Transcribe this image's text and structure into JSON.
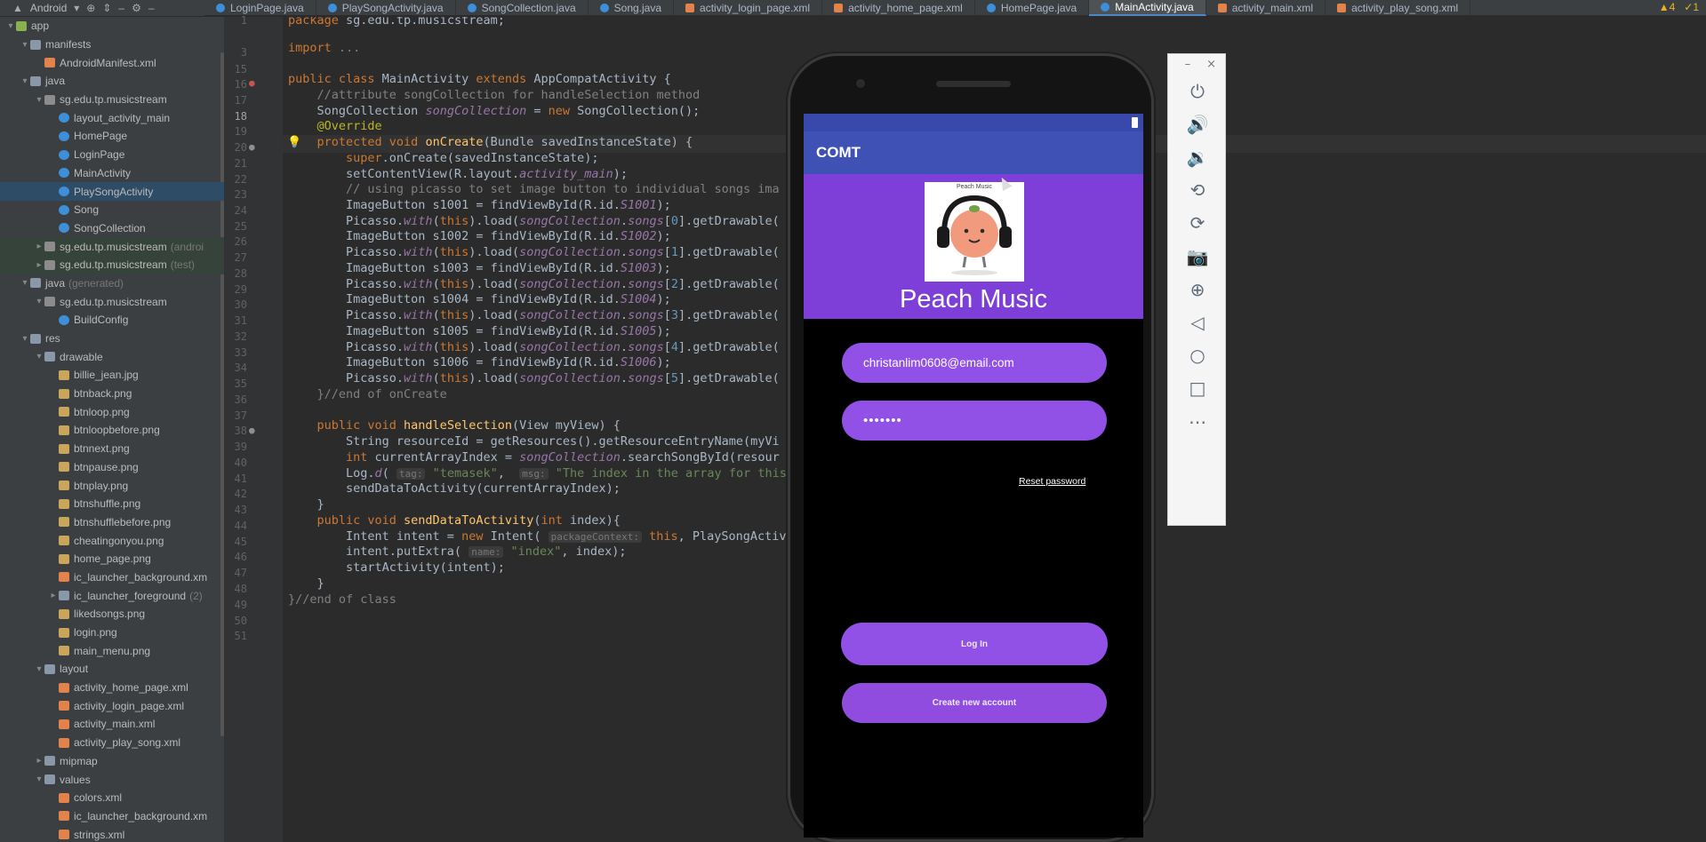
{
  "topbar": {
    "project_selector": "Android",
    "tabs": [
      {
        "label": "LoginPage.java",
        "type": "java"
      },
      {
        "label": "PlaySongActivity.java",
        "type": "java"
      },
      {
        "label": "SongCollection.java",
        "type": "java"
      },
      {
        "label": "Song.java",
        "type": "java"
      },
      {
        "label": "activity_login_page.xml",
        "type": "xml"
      },
      {
        "label": "activity_home_page.xml",
        "type": "xml"
      },
      {
        "label": "HomePage.java",
        "type": "java"
      },
      {
        "label": "MainActivity.java",
        "type": "java",
        "active": true
      },
      {
        "label": "activity_main.xml",
        "type": "xml"
      },
      {
        "label": "activity_play_song.xml",
        "type": "xml"
      }
    ],
    "warnings": "▲4",
    "errors": "✓1"
  },
  "tree": [
    {
      "label": "app",
      "indent": 0,
      "icon": "mod",
      "chev": "▾"
    },
    {
      "label": "manifests",
      "indent": 1,
      "icon": "folder",
      "chev": "▾"
    },
    {
      "label": "AndroidManifest.xml",
      "indent": 2,
      "icon": "xml",
      "chev": ""
    },
    {
      "label": "java",
      "indent": 1,
      "icon": "folder",
      "chev": "▾"
    },
    {
      "label": "sg.edu.tp.musicstream",
      "indent": 2,
      "icon": "pkg",
      "chev": "▾"
    },
    {
      "label": "layout_activity_main",
      "indent": 3,
      "icon": "cls",
      "chev": ""
    },
    {
      "label": "HomePage",
      "indent": 3,
      "icon": "cls",
      "chev": ""
    },
    {
      "label": "LoginPage",
      "indent": 3,
      "icon": "cls",
      "chev": ""
    },
    {
      "label": "MainActivity",
      "indent": 3,
      "icon": "cls",
      "chev": ""
    },
    {
      "label": "PlaySongActivity",
      "indent": 3,
      "icon": "cls",
      "chev": "",
      "selected": true
    },
    {
      "label": "Song",
      "indent": 3,
      "icon": "cls",
      "chev": ""
    },
    {
      "label": "SongCollection",
      "indent": 3,
      "icon": "cls",
      "chev": ""
    },
    {
      "label": "sg.edu.tp.musicstream",
      "suffix": "(androi",
      "indent": 2,
      "icon": "pkg",
      "chev": "▸",
      "modbg": true
    },
    {
      "label": "sg.edu.tp.musicstream",
      "suffix": "(test)",
      "indent": 2,
      "icon": "pkg",
      "chev": "▸",
      "modbg": true
    },
    {
      "label": "java",
      "suffix": "(generated)",
      "indent": 1,
      "icon": "folder",
      "chev": "▾"
    },
    {
      "label": "sg.edu.tp.musicstream",
      "indent": 2,
      "icon": "pkg",
      "chev": "▾"
    },
    {
      "label": "BuildConfig",
      "indent": 3,
      "icon": "cls",
      "chev": ""
    },
    {
      "label": "res",
      "indent": 1,
      "icon": "folder",
      "chev": "▾"
    },
    {
      "label": "drawable",
      "indent": 2,
      "icon": "folder",
      "chev": "▾"
    },
    {
      "label": "billie_jean.jpg",
      "indent": 3,
      "icon": "img",
      "chev": ""
    },
    {
      "label": "btnback.png",
      "indent": 3,
      "icon": "img",
      "chev": ""
    },
    {
      "label": "btnloop.png",
      "indent": 3,
      "icon": "img",
      "chev": ""
    },
    {
      "label": "btnloopbefore.png",
      "indent": 3,
      "icon": "img",
      "chev": ""
    },
    {
      "label": "btnnext.png",
      "indent": 3,
      "icon": "img",
      "chev": ""
    },
    {
      "label": "btnpause.png",
      "indent": 3,
      "icon": "img",
      "chev": ""
    },
    {
      "label": "btnplay.png",
      "indent": 3,
      "icon": "img",
      "chev": ""
    },
    {
      "label": "btnshuffle.png",
      "indent": 3,
      "icon": "img",
      "chev": ""
    },
    {
      "label": "btnshufflebefore.png",
      "indent": 3,
      "icon": "img",
      "chev": ""
    },
    {
      "label": "cheatingonyou.png",
      "indent": 3,
      "icon": "img",
      "chev": ""
    },
    {
      "label": "home_page.png",
      "indent": 3,
      "icon": "img",
      "chev": ""
    },
    {
      "label": "ic_launcher_background.xm",
      "indent": 3,
      "icon": "xml",
      "chev": ""
    },
    {
      "label": "ic_launcher_foreground",
      "suffix": "(2)",
      "indent": 3,
      "icon": "folder",
      "chev": "▸"
    },
    {
      "label": "likedsongs.png",
      "indent": 3,
      "icon": "img",
      "chev": ""
    },
    {
      "label": "login.png",
      "indent": 3,
      "icon": "img",
      "chev": ""
    },
    {
      "label": "main_menu.png",
      "indent": 3,
      "icon": "img",
      "chev": ""
    },
    {
      "label": "layout",
      "indent": 2,
      "icon": "folder",
      "chev": "▾"
    },
    {
      "label": "activity_home_page.xml",
      "indent": 3,
      "icon": "xml",
      "chev": ""
    },
    {
      "label": "activity_login_page.xml",
      "indent": 3,
      "icon": "xml",
      "chev": ""
    },
    {
      "label": "activity_main.xml",
      "indent": 3,
      "icon": "xml",
      "chev": ""
    },
    {
      "label": "activity_play_song.xml",
      "indent": 3,
      "icon": "xml",
      "chev": ""
    },
    {
      "label": "mipmap",
      "indent": 2,
      "icon": "folder",
      "chev": "▸"
    },
    {
      "label": "values",
      "indent": 2,
      "icon": "folder",
      "chev": "▾"
    },
    {
      "label": "colors.xml",
      "indent": 3,
      "icon": "xml",
      "chev": ""
    },
    {
      "label": "ic_launcher_background.xm",
      "indent": 3,
      "icon": "xml",
      "chev": ""
    },
    {
      "label": "strings.xml",
      "indent": 3,
      "icon": "xml",
      "chev": ""
    }
  ],
  "gutter": {
    "line_numbers": [
      "1",
      "3",
      "15",
      "16",
      "17",
      "18",
      "19",
      "20",
      "21",
      "22",
      "23",
      "24",
      "25",
      "26",
      "27",
      "28",
      "29",
      "30",
      "31",
      "32",
      "33",
      "34",
      "35",
      "36",
      "37",
      "38",
      "39",
      "40",
      "41",
      "42",
      "43",
      "44",
      "45",
      "46",
      "47",
      "48",
      "49",
      "50",
      "51"
    ],
    "current_line": "18"
  },
  "code": [
    {
      "segs": [
        [
          "kw",
          "package "
        ],
        [
          "",
          "sg.edu.tp.musicstream;"
        ]
      ]
    },
    {
      "segs": [
        [
          "kw",
          "import "
        ],
        [
          "cm",
          "..."
        ]
      ]
    },
    {
      "segs": []
    },
    {
      "segs": [
        [
          "kw",
          "public class "
        ],
        [
          "",
          "MainActivity "
        ],
        [
          "kw",
          "extends "
        ],
        [
          "",
          "AppCompatActivity {"
        ]
      ]
    },
    {
      "segs": [
        [
          "cm",
          "    //attribute songCollection for handleSelection method"
        ]
      ]
    },
    {
      "segs": [
        [
          "",
          "    SongCollection "
        ],
        [
          "it",
          "songCollection"
        ],
        [
          "",
          " = "
        ],
        [
          "kw",
          "new "
        ],
        [
          "",
          "SongCollection();"
        ]
      ]
    },
    {
      "segs": [
        [
          "an",
          "    @Override"
        ]
      ]
    },
    {
      "segs": [
        [
          "kw",
          "    protected void "
        ],
        [
          "fn",
          "onCreate"
        ],
        [
          "",
          "(Bundle savedInstanceState) {"
        ]
      ]
    },
    {
      "segs": [
        [
          "kw",
          "        super"
        ],
        [
          "",
          ".onCreate(savedInstanceState);"
        ]
      ]
    },
    {
      "segs": [
        [
          "",
          "        setContentView(R.layout."
        ],
        [
          "it",
          "activity_main"
        ],
        [
          "",
          ");"
        ]
      ]
    },
    {
      "segs": [
        [
          "cm",
          "        // using picasso to set image button to individual songs ima"
        ]
      ]
    },
    {
      "segs": [
        [
          "",
          "        ImageButton s1001 = findViewById(R.id."
        ],
        [
          "it",
          "S1001"
        ],
        [
          "",
          ");"
        ]
      ]
    },
    {
      "segs": [
        [
          "",
          "        Picasso."
        ],
        [
          "it",
          "with"
        ],
        [
          "",
          "("
        ],
        [
          "kw",
          "this"
        ],
        [
          "",
          ").load("
        ],
        [
          "it",
          "songCollection"
        ],
        [
          "",
          "."
        ],
        [
          "it",
          "songs"
        ],
        [
          "",
          "["
        ],
        [
          "num",
          "0"
        ],
        [
          "",
          "].getDrawable("
        ]
      ]
    },
    {
      "segs": [
        [
          "",
          "        ImageButton s1002 = findViewById(R.id."
        ],
        [
          "it",
          "S1002"
        ],
        [
          "",
          ");"
        ]
      ]
    },
    {
      "segs": [
        [
          "",
          "        Picasso."
        ],
        [
          "it",
          "with"
        ],
        [
          "",
          "("
        ],
        [
          "kw",
          "this"
        ],
        [
          "",
          ").load("
        ],
        [
          "it",
          "songCollection"
        ],
        [
          "",
          "."
        ],
        [
          "it",
          "songs"
        ],
        [
          "",
          "["
        ],
        [
          "num",
          "1"
        ],
        [
          "",
          "].getDrawable("
        ]
      ]
    },
    {
      "segs": [
        [
          "",
          "        ImageButton s1003 = findViewById(R.id."
        ],
        [
          "it",
          "S1003"
        ],
        [
          "",
          ");"
        ]
      ]
    },
    {
      "segs": [
        [
          "",
          "        Picasso."
        ],
        [
          "it",
          "with"
        ],
        [
          "",
          "("
        ],
        [
          "kw",
          "this"
        ],
        [
          "",
          ").load("
        ],
        [
          "it",
          "songCollection"
        ],
        [
          "",
          "."
        ],
        [
          "it",
          "songs"
        ],
        [
          "",
          "["
        ],
        [
          "num",
          "2"
        ],
        [
          "",
          "].getDrawable("
        ]
      ]
    },
    {
      "segs": [
        [
          "",
          "        ImageButton s1004 = findViewById(R.id."
        ],
        [
          "it",
          "S1004"
        ],
        [
          "",
          ");"
        ]
      ]
    },
    {
      "segs": [
        [
          "",
          "        Picasso."
        ],
        [
          "it",
          "with"
        ],
        [
          "",
          "("
        ],
        [
          "kw",
          "this"
        ],
        [
          "",
          ").load("
        ],
        [
          "it",
          "songCollection"
        ],
        [
          "",
          "."
        ],
        [
          "it",
          "songs"
        ],
        [
          "",
          "["
        ],
        [
          "num",
          "3"
        ],
        [
          "",
          "].getDrawable("
        ]
      ]
    },
    {
      "segs": [
        [
          "",
          "        ImageButton s1005 = findViewById(R.id."
        ],
        [
          "it",
          "S1005"
        ],
        [
          "",
          ");"
        ]
      ]
    },
    {
      "segs": [
        [
          "",
          "        Picasso."
        ],
        [
          "it",
          "with"
        ],
        [
          "",
          "("
        ],
        [
          "kw",
          "this"
        ],
        [
          "",
          ").load("
        ],
        [
          "it",
          "songCollection"
        ],
        [
          "",
          "."
        ],
        [
          "it",
          "songs"
        ],
        [
          "",
          "["
        ],
        [
          "num",
          "4"
        ],
        [
          "",
          "].getDrawable("
        ]
      ]
    },
    {
      "segs": [
        [
          "",
          "        ImageButton s1006 = findViewById(R.id."
        ],
        [
          "it",
          "S1006"
        ],
        [
          "",
          ");"
        ]
      ]
    },
    {
      "segs": [
        [
          "",
          "        Picasso."
        ],
        [
          "it",
          "with"
        ],
        [
          "",
          "("
        ],
        [
          "kw",
          "this"
        ],
        [
          "",
          ").load("
        ],
        [
          "it",
          "songCollection"
        ],
        [
          "",
          "."
        ],
        [
          "it",
          "songs"
        ],
        [
          "",
          "["
        ],
        [
          "num",
          "5"
        ],
        [
          "",
          "].getDrawable("
        ]
      ]
    },
    {
      "segs": [
        [
          "cm",
          "    }//end of onCreate"
        ]
      ]
    },
    {
      "segs": []
    },
    {
      "segs": [
        [
          "kw",
          "    public void "
        ],
        [
          "fn",
          "handleSelection"
        ],
        [
          "",
          "(View myView) {"
        ]
      ]
    },
    {
      "segs": [
        [
          "",
          "        String resourceId = getResources().getResourceEntryName(myVi"
        ]
      ]
    },
    {
      "segs": [
        [
          "kw",
          "        int "
        ],
        [
          "",
          "currentArrayIndex = "
        ],
        [
          "it",
          "songCollection"
        ],
        [
          "",
          ".searchSongById(resour"
        ]
      ]
    },
    {
      "segs": [
        [
          "",
          "        Log."
        ],
        [
          "it",
          "d"
        ],
        [
          "",
          "( "
        ],
        [
          "hint",
          "tag:"
        ],
        [
          "st",
          " \"temasek\""
        ],
        [
          "",
          ",  "
        ],
        [
          "hint",
          "msg:"
        ],
        [
          "st",
          " \"The index in the array for this"
        ]
      ]
    },
    {
      "segs": [
        [
          "",
          "        sendDataToActivity(currentArrayIndex);"
        ]
      ]
    },
    {
      "segs": [
        [
          "",
          "    }"
        ]
      ]
    },
    {
      "segs": [
        [
          "kw",
          "    public void "
        ],
        [
          "fn",
          "sendDataToActivity"
        ],
        [
          "",
          "("
        ],
        [
          "kw",
          "int "
        ],
        [
          "",
          "index){"
        ]
      ]
    },
    {
      "segs": [
        [
          "",
          "        Intent intent = "
        ],
        [
          "kw",
          "new "
        ],
        [
          "",
          "Intent( "
        ],
        [
          "hint",
          "packageContext:"
        ],
        [
          "",
          " "
        ],
        [
          "kw",
          "this"
        ],
        [
          "",
          ", PlaySongActivi"
        ]
      ]
    },
    {
      "segs": [
        [
          "",
          "        intent.putExtra( "
        ],
        [
          "hint",
          "name:"
        ],
        [
          "st",
          " \"index\""
        ],
        [
          "",
          ", index);"
        ]
      ]
    },
    {
      "segs": [
        [
          "",
          "        startActivity(intent);"
        ]
      ]
    },
    {
      "segs": [
        [
          "",
          "    }"
        ]
      ]
    },
    {
      "segs": [
        [
          "cm",
          "}//end of class"
        ]
      ]
    },
    {
      "segs": []
    }
  ],
  "phone": {
    "app_bar_title": "COMT",
    "logo_caption": "Peach Music",
    "hero_title": "Peach Music",
    "email_value": "christanlim0608@email.com",
    "password_value": "•••••••",
    "reset_link": "Reset password",
    "login_button": "Log In",
    "create_button": "Create new account",
    "colors": {
      "status_bar": "#3949ab",
      "app_bar": "#3f51b5",
      "hero": "#7e3fd8",
      "pill": "#9150e6"
    }
  },
  "emulator": {
    "window_controls": [
      "–",
      "×"
    ],
    "tools": [
      {
        "name": "power-icon",
        "glyph": "⏻"
      },
      {
        "name": "volume-up-icon",
        "glyph": "🔊"
      },
      {
        "name": "volume-down-icon",
        "glyph": "🔉"
      },
      {
        "name": "rotate-left-icon",
        "glyph": "⟲"
      },
      {
        "name": "rotate-right-icon",
        "glyph": "⟳"
      },
      {
        "name": "camera-icon",
        "glyph": "📷"
      },
      {
        "name": "zoom-icon",
        "glyph": "⊕"
      },
      {
        "name": "back-icon",
        "glyph": "◁"
      },
      {
        "name": "home-icon",
        "glyph": "○"
      },
      {
        "name": "overview-icon",
        "glyph": "□"
      },
      {
        "name": "more-icon",
        "glyph": "⋯"
      }
    ]
  }
}
